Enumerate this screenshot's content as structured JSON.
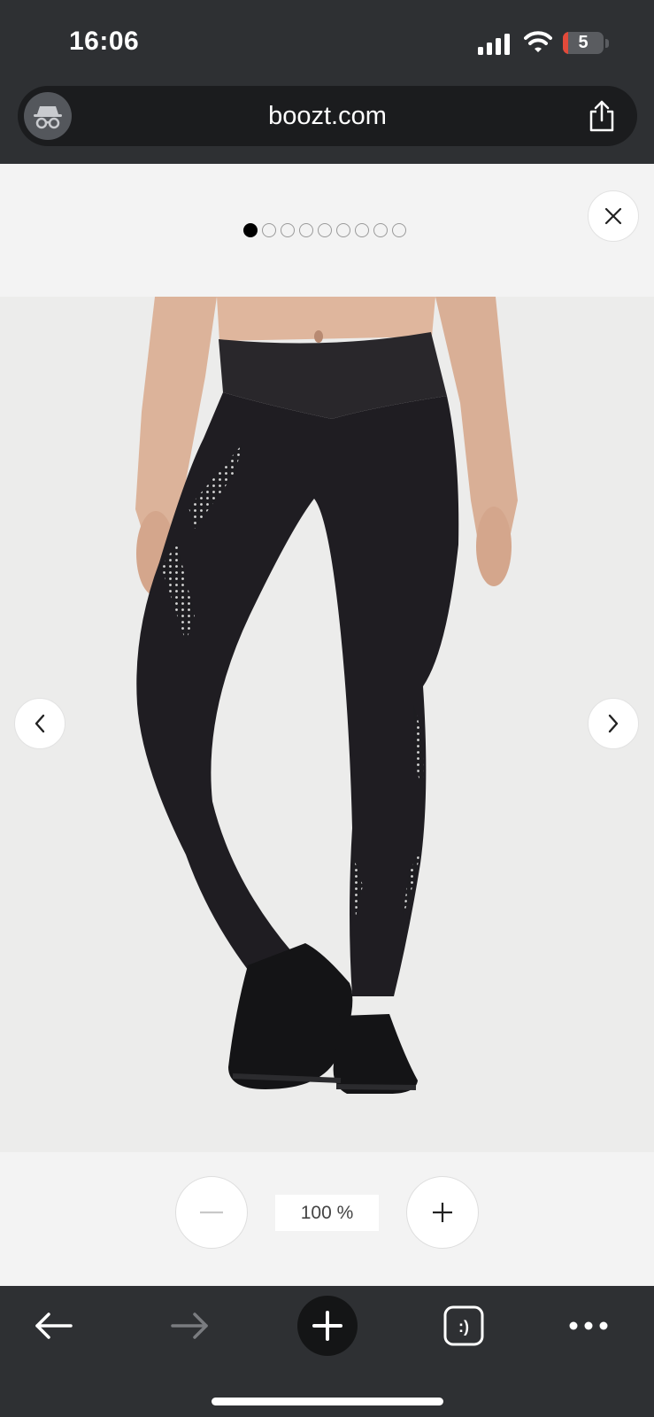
{
  "status_bar": {
    "time": "16:06",
    "battery_level": "5",
    "icons": [
      "signal-icon",
      "wifi-icon",
      "battery-icon"
    ]
  },
  "browser": {
    "url": "boozt.com",
    "icons": [
      "incognito-icon",
      "share-icon"
    ]
  },
  "gallery": {
    "image_count": 9,
    "active_index": 0,
    "close_icon": "close-icon",
    "prev_icon": "chevron-left-icon",
    "next_icon": "chevron-right-icon"
  },
  "zoom": {
    "level": "100 %",
    "minus_icon": "minus-icon",
    "plus_icon": "plus-icon"
  },
  "toolbar": {
    "icons": [
      "back-arrow-icon",
      "forward-arrow-icon",
      "new-tab-plus-icon",
      "tabs-icon",
      "more-icon"
    ],
    "tabs_glyph": ":)"
  },
  "colors": {
    "chrome_background": "#2e3033",
    "address_bar": "#1b1c1e",
    "page_background": "#f3f3f3",
    "battery_low": "#e24a3a"
  }
}
